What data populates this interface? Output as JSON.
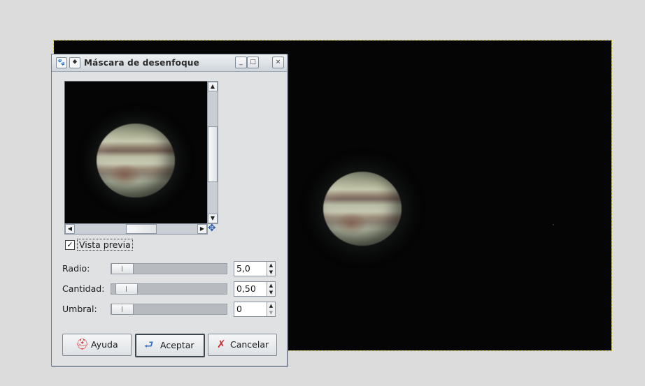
{
  "dialog": {
    "title": "Máscara de desenfoque",
    "titlebar_icons": {
      "app": "wilber-icon",
      "menu": "window-menu-icon"
    },
    "window_buttons": {
      "minimize": "_",
      "maximize": "□",
      "close": "×"
    }
  },
  "preview": {
    "checkbox_label": "Vista previa",
    "checked": true,
    "check_mark": "✓"
  },
  "params": [
    {
      "label": "Radio:",
      "value": "5,0",
      "slider_fraction": 0.05
    },
    {
      "label": "Cantidad:",
      "value": "0,50",
      "slider_fraction": 0.1
    },
    {
      "label": "Umbral:",
      "value": "0",
      "slider_fraction": 0.0
    }
  ],
  "buttons": {
    "help": "Ayuda",
    "ok": "Aceptar",
    "cancel": "Cancelar"
  },
  "icons": {
    "help": "lifebuoy-icon",
    "ok": "return-arrow-icon",
    "cancel": "red-x-icon",
    "navigate": "move-cross-icon"
  },
  "colors": {
    "canvas_bg": "#050506",
    "selection_outline": "#c9c34a",
    "dialog_bg": "#dfe1e3"
  }
}
